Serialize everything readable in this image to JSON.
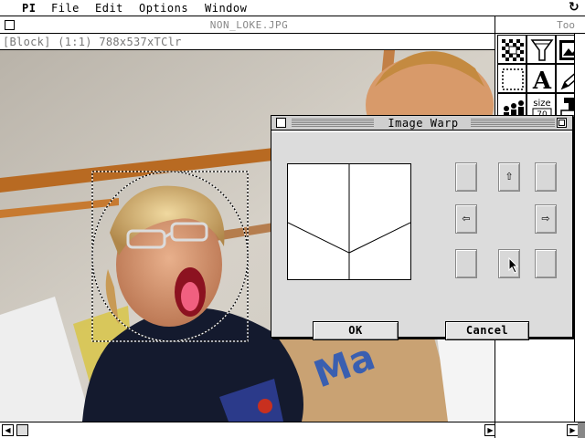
{
  "menubar": {
    "app": "PI",
    "items": [
      "File",
      "Edit",
      "Options",
      "Window"
    ],
    "right_icon": "sync-icon"
  },
  "image_window": {
    "title": "NON_LOKE.JPG",
    "status": "[Block] (1:1) 788x537xTClr",
    "selection_shape": "ellipse"
  },
  "tools": {
    "title": "Too",
    "icons": [
      "checker-pattern-icon",
      "funnel-icon",
      "picture-frame-icon",
      "dotted-frame-icon",
      "text-tool-icon",
      "pencil-icon",
      "people-icon",
      "size-icon",
      "stamp-icon"
    ],
    "size_label": "size",
    "size_value": "70",
    "text_glyph": "A"
  },
  "dialog": {
    "title": "Image Warp",
    "arrows": {
      "up": "⇧",
      "left": "⇦",
      "right": "⇨"
    },
    "ok": "OK",
    "cancel": "Cancel"
  },
  "colors": {
    "dialog_bg": "#dcdcdc",
    "title_text_inactive": "#888888"
  }
}
